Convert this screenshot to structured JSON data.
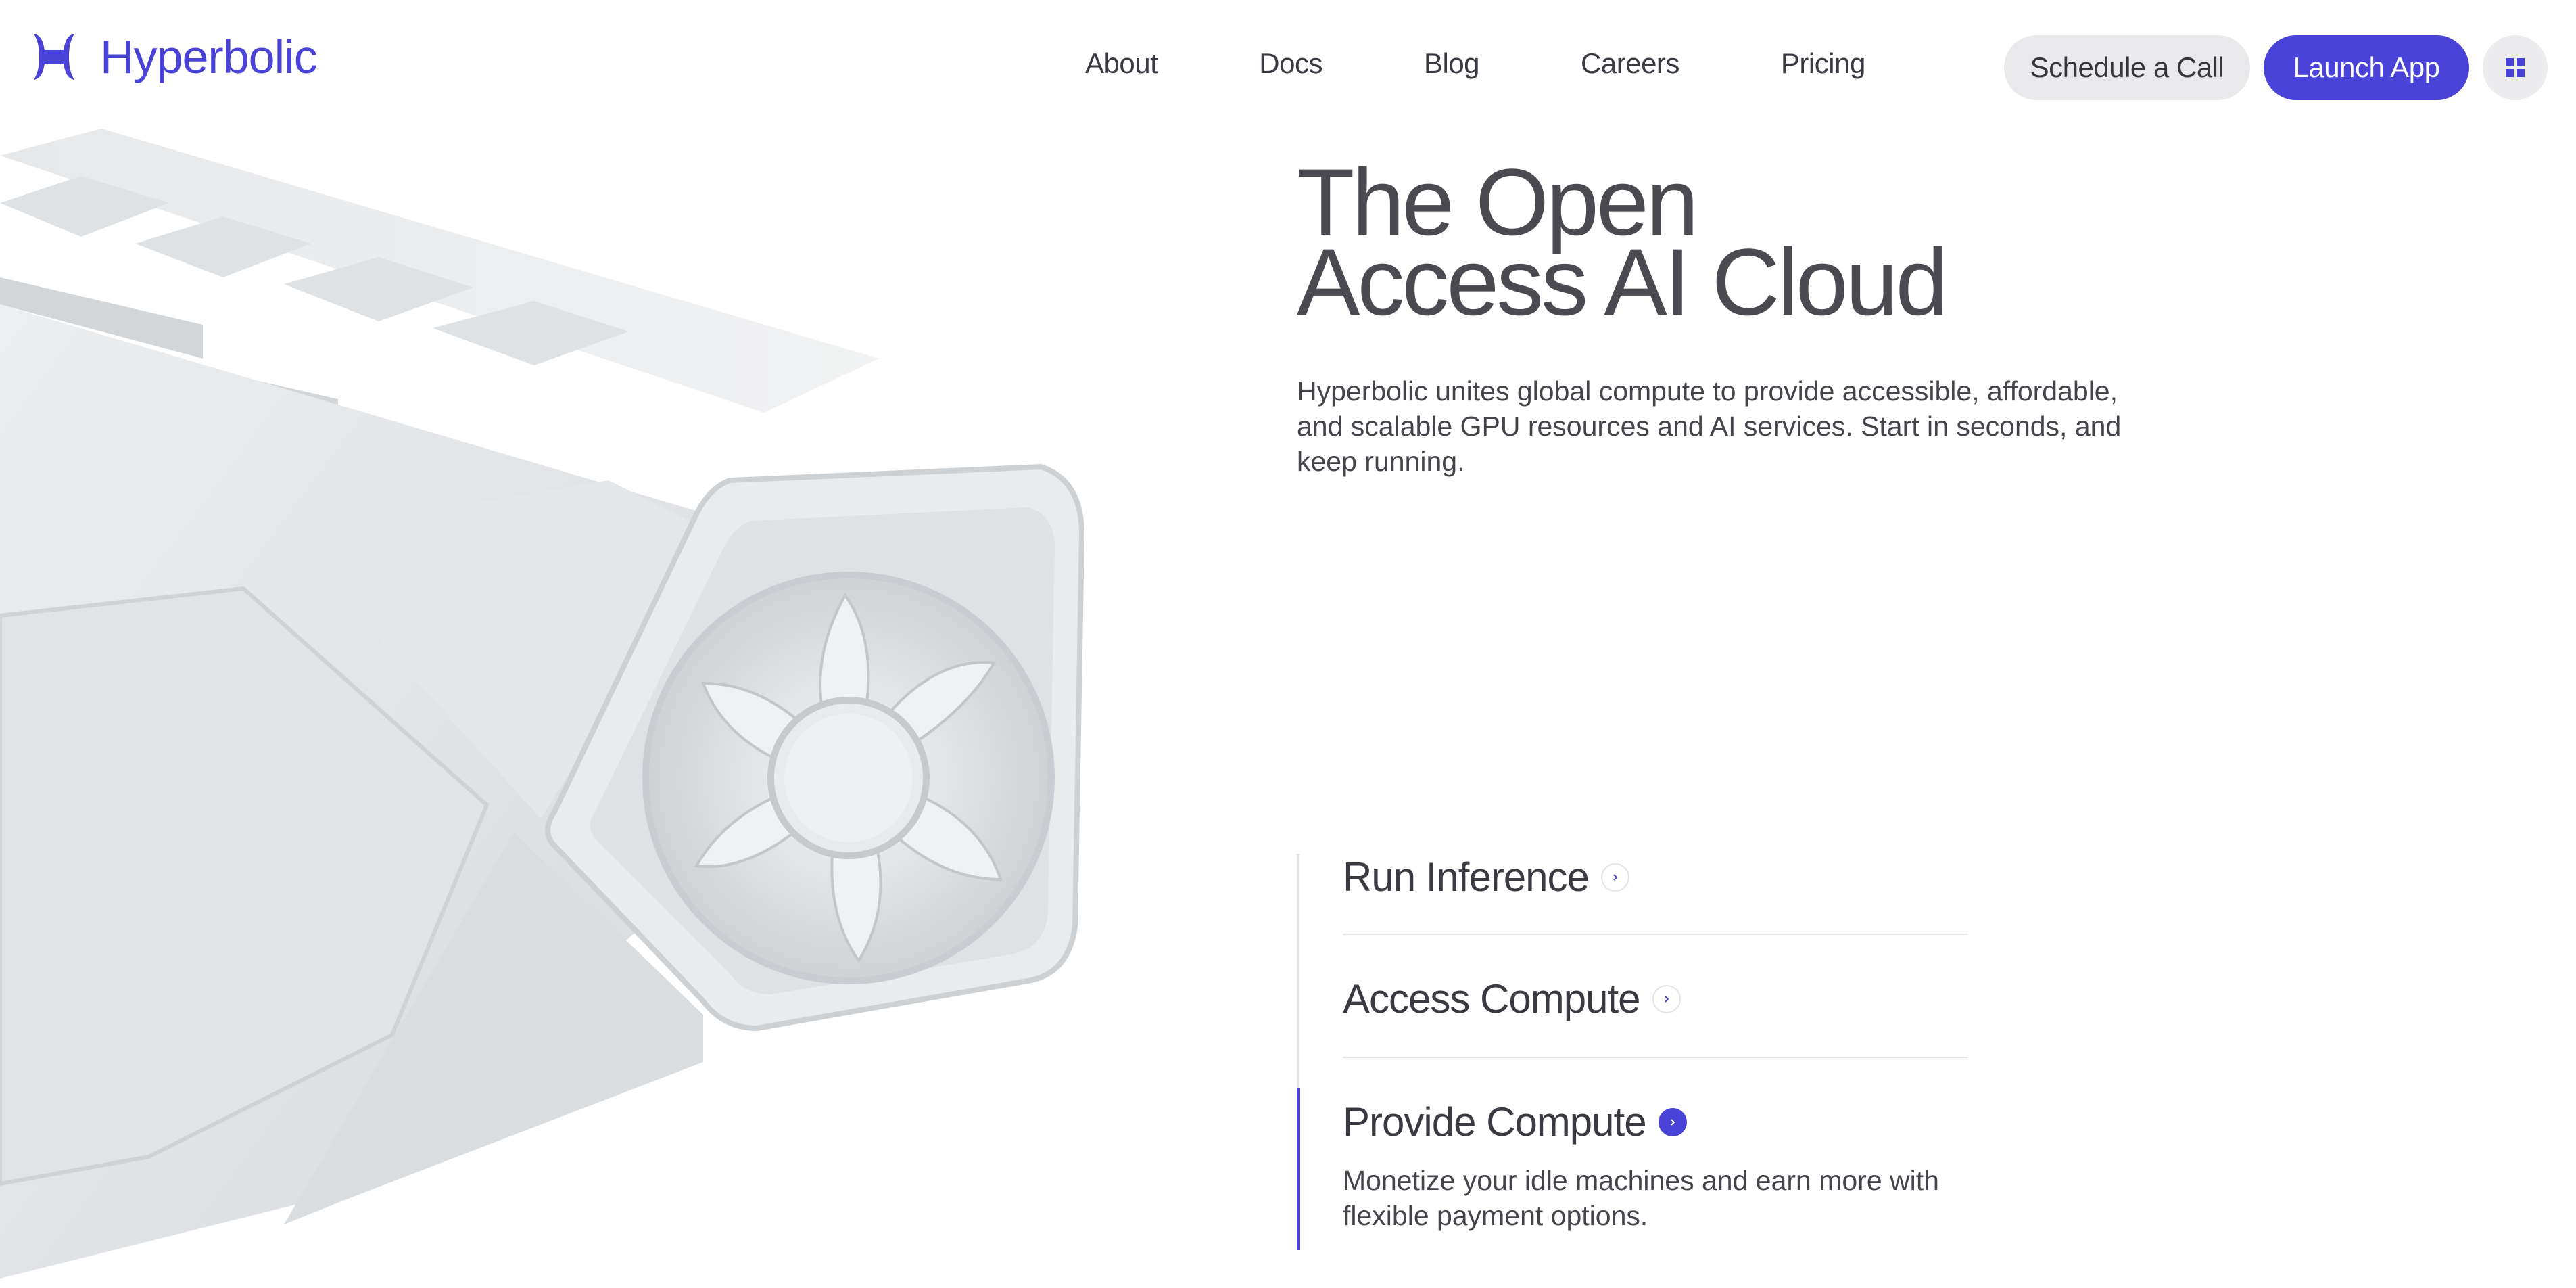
{
  "brand": {
    "name": "Hyperbolic",
    "accent": "#4a43d8"
  },
  "nav": {
    "items": [
      "About",
      "Docs",
      "Blog",
      "Careers",
      "Pricing"
    ]
  },
  "actions": {
    "schedule_label": "Schedule a Call",
    "launch_label": "Launch App",
    "menu_icon": "grid-icon"
  },
  "hero": {
    "title_line1": "The Open",
    "title_line2": "Access AI Cloud",
    "description": "Hyperbolic unites global compute to provide accessible, affordable, and scalable GPU resources and AI services. Start in seconds, and keep running."
  },
  "features": [
    {
      "title": "Run Inference",
      "active": false
    },
    {
      "title": "Access Compute",
      "active": false
    },
    {
      "title": "Provide Compute",
      "active": true,
      "description": "Monetize your idle machines and earn more with flexible payment options."
    }
  ]
}
